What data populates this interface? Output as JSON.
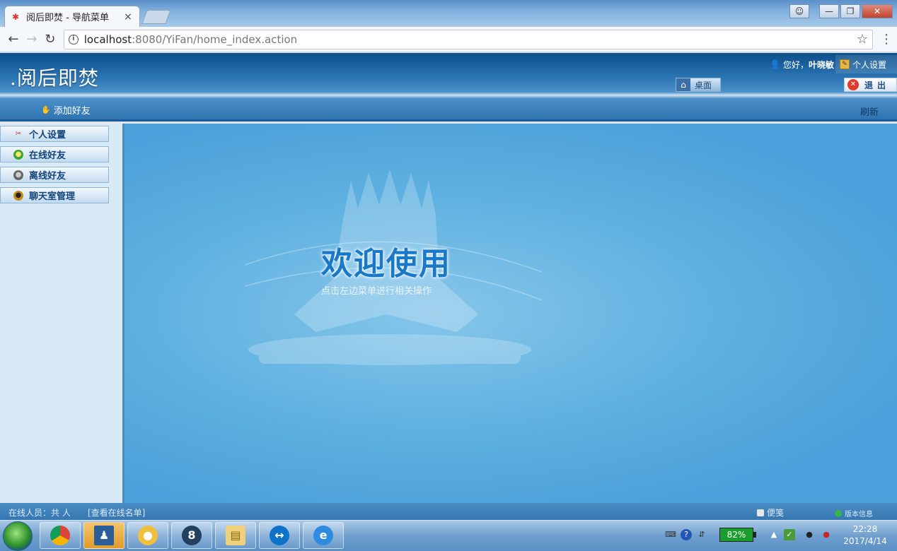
{
  "browser": {
    "tab_title": "阅后即焚 - 导航菜单",
    "tab_close": "×",
    "url_host": "localhost",
    "url_rest": ":8080/YiFan/home_index.action",
    "win_min": "—",
    "win_max": "❐",
    "win_close": "✕"
  },
  "header": {
    "app_title": ".阅后即焚",
    "greeting_prefix": "您好，",
    "user_name": "叶晓敏",
    "settings_label": "个人设置",
    "desktop_label": "桌面",
    "logout_label": "退出"
  },
  "subbar": {
    "add_friend_label": "添加好友",
    "refresh_label": "刷新"
  },
  "sidebar": {
    "items": [
      {
        "label": "个人设置",
        "icon": "tools-icon",
        "color": "#c0392b"
      },
      {
        "label": "在线好友",
        "icon": "online-user-icon",
        "color": "#3aa836"
      },
      {
        "label": "离线好友",
        "icon": "offline-user-icon",
        "color": "#666666"
      },
      {
        "label": "聊天室管理",
        "icon": "chatroom-admin-icon",
        "color": "#c78a1e"
      }
    ]
  },
  "main": {
    "welcome_title": "欢迎使用",
    "welcome_subtitle": "点击左边菜单进行相关操作"
  },
  "status": {
    "online_text": "在线人员：共 人",
    "view_online_label": "[查看在线名单]",
    "notes_label": "便笺",
    "version_label": "版本信息"
  },
  "taskbar": {
    "battery_level": "82%",
    "time": "22:28",
    "date": "2017/4/14"
  },
  "colors": {
    "header_dark": "#0b4e8a",
    "main_blue": "#5eb0e0",
    "welcome_text": "#1a78c8",
    "battery_green": "#1a9d2e"
  }
}
